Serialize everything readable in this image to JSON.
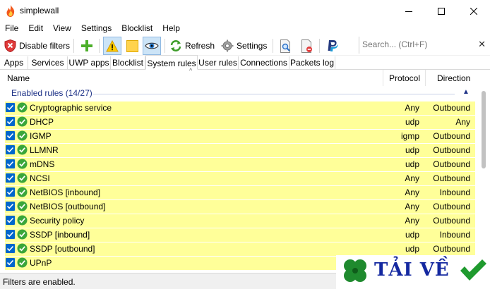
{
  "window": {
    "title": "simplewall",
    "icon": "flame-icon"
  },
  "menu": [
    "File",
    "Edit",
    "View",
    "Settings",
    "Blocklist",
    "Help"
  ],
  "toolbar": {
    "disable_filters_label": "Disable filters",
    "refresh_label": "Refresh",
    "settings_label": "Settings",
    "search_placeholder": "Search... (Ctrl+F)"
  },
  "tabs": [
    "Apps",
    "Services",
    "UWP apps",
    "Blocklist",
    "System rules",
    "User rules",
    "Connections",
    "Packets log"
  ],
  "active_tab": "System rules",
  "list": {
    "columns": {
      "name": "Name",
      "protocol": "Protocol",
      "direction": "Direction"
    },
    "group_title": "Enabled rules (14/27)",
    "rows": [
      {
        "name": "Cryptographic service",
        "protocol": "Any",
        "direction": "Outbound"
      },
      {
        "name": "DHCP",
        "protocol": "udp",
        "direction": "Any"
      },
      {
        "name": "IGMP",
        "protocol": "igmp",
        "direction": "Outbound"
      },
      {
        "name": "LLMNR",
        "protocol": "udp",
        "direction": "Outbound"
      },
      {
        "name": "mDNS",
        "protocol": "udp",
        "direction": "Outbound"
      },
      {
        "name": "NCSI",
        "protocol": "Any",
        "direction": "Outbound"
      },
      {
        "name": "NetBIOS [inbound]",
        "protocol": "Any",
        "direction": "Inbound"
      },
      {
        "name": "NetBIOS [outbound]",
        "protocol": "Any",
        "direction": "Outbound"
      },
      {
        "name": "Security policy",
        "protocol": "Any",
        "direction": "Outbound"
      },
      {
        "name": "SSDP [inbound]",
        "protocol": "udp",
        "direction": "Inbound"
      },
      {
        "name": "SSDP [outbound]",
        "protocol": "udp",
        "direction": "Outbound"
      },
      {
        "name": "UPnP",
        "protocol": "",
        "direction": ""
      }
    ]
  },
  "status": {
    "text": "Filters are enabled."
  },
  "watermark": {
    "text": "TẢI VỀ"
  },
  "colors": {
    "row_highlight": "#ffff99",
    "group_title": "#1e3287",
    "checkbox": "#0066cc",
    "ok_green": "#3aa63a"
  }
}
